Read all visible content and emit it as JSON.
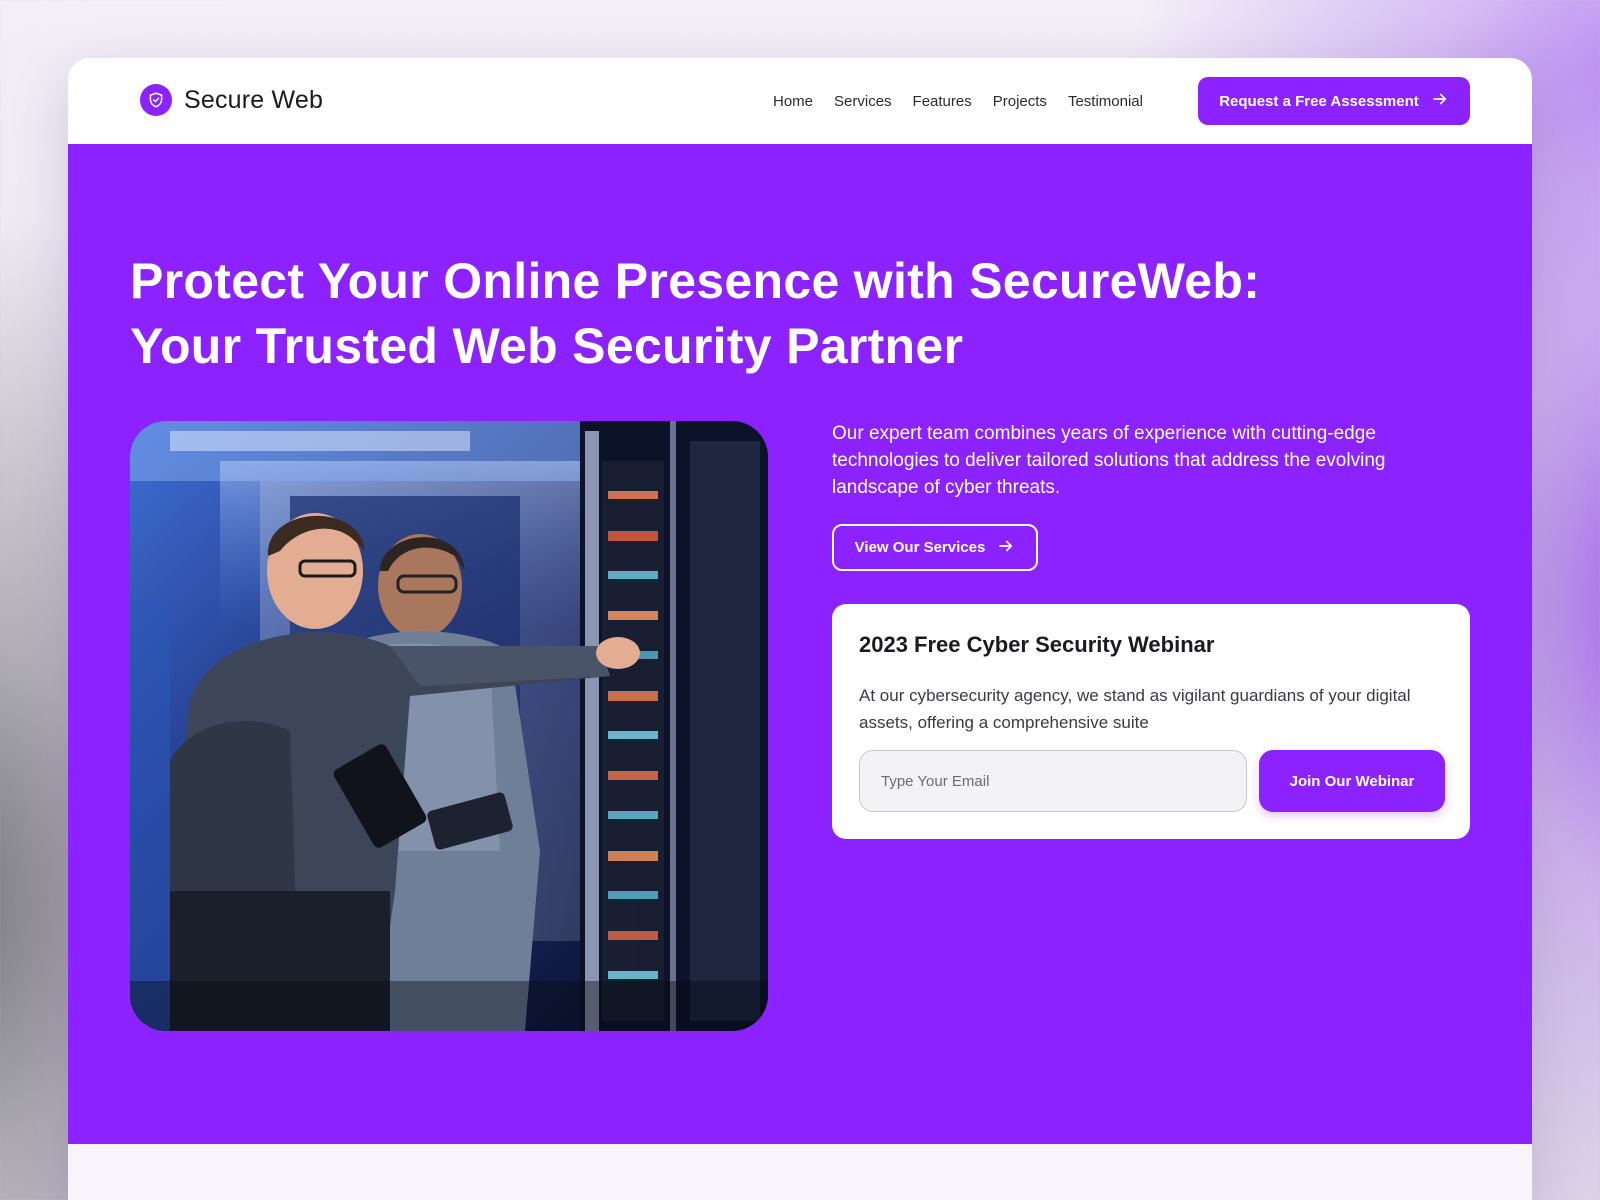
{
  "header": {
    "logo_text": "Secure Web",
    "nav": [
      "Home",
      "Services",
      "Features",
      "Projects",
      "Testimonial"
    ],
    "cta_label": "Request a Free Assessment"
  },
  "hero": {
    "title_line1": "Protect Your Online Presence with SecureWeb:",
    "title_line2": "Your Trusted Web Security Partner",
    "description": "Our expert team combines years of experience with cutting-edge technologies to deliver tailored solutions that address the evolving landscape of cyber threats.",
    "services_button": "View Our Services"
  },
  "webinar": {
    "title": "2023 Free Cyber Security Webinar",
    "description": "At our cybersecurity agency, we stand as vigilant guardians of your digital assets, offering a comprehensive suite",
    "email_placeholder": "Type Your Email",
    "join_button": "Join Our Webinar"
  },
  "colors": {
    "brand": "#8b22ff",
    "white": "#ffffff",
    "text_dark": "#1b1b1f"
  },
  "icons": [
    "shield-check-icon",
    "arrow-right-icon"
  ]
}
